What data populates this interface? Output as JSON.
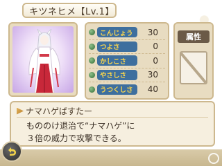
{
  "character": {
    "name": "キツネヒメ",
    "level": "【Lv.1】"
  },
  "stats": [
    {
      "label": "こんじょう",
      "value": "30"
    },
    {
      "label": "つよさ",
      "value": "0"
    },
    {
      "label": "かしこさ",
      "value": "0"
    },
    {
      "label": "やさしさ",
      "value": "30"
    },
    {
      "label": "うつくしさ",
      "value": "40"
    }
  ],
  "attribute": {
    "label": "属性",
    "value_icon": "empty-slash-icon"
  },
  "skill": {
    "name": "ナマハゲばすたー",
    "description_line1": "もののけ退治で“ナマハゲ”に",
    "description_line2": "３倍の威力で攻撃できる。"
  },
  "icons": {
    "back": "back-arrow-icon",
    "watermark": "g-logo-icon"
  },
  "colors": {
    "stat_label_bg": "#3e6f9e",
    "stat_label_text": "#ffd84a",
    "panel_border": "#cdb88e",
    "portrait_bg": "#c7a6e6"
  }
}
